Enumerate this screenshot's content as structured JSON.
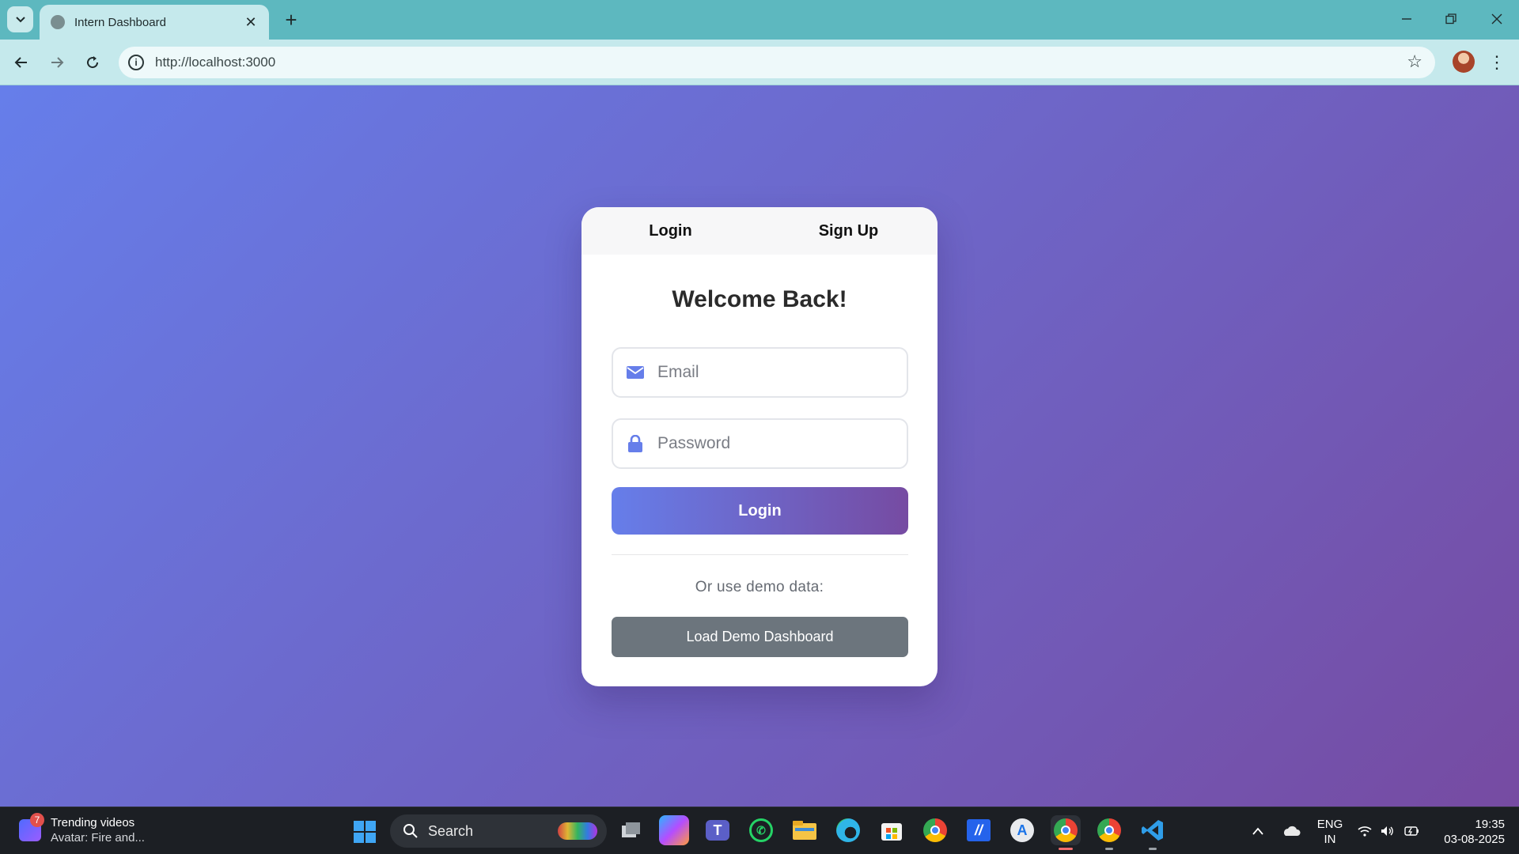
{
  "browser": {
    "tab_title": "Intern Dashboard",
    "url": "http://localhost:3000"
  },
  "auth": {
    "tabs": [
      "Login",
      "Sign Up"
    ],
    "heading": "Welcome Back!",
    "email_placeholder": "Email",
    "password_placeholder": "Password",
    "login_button": "Login",
    "demo_text": "Or use demo data:",
    "demo_button": "Load Demo Dashboard",
    "accent_start": "#667eea",
    "accent_end": "#764ba2"
  },
  "taskbar": {
    "news_badge": "7",
    "news_title": "Trending videos",
    "news_subtitle": "Avatar: Fire and...",
    "search_label": "Search",
    "lang_line1": "ENG",
    "lang_line2": "IN",
    "time": "19:35",
    "date": "03-08-2025",
    "apps": [
      "task-view",
      "copilot",
      "teams",
      "whatsapp",
      "file-explorer",
      "edge",
      "microsoft-store",
      "chrome",
      "app",
      "android-studio",
      "chrome-active",
      "chrome-profile",
      "vscode"
    ]
  }
}
